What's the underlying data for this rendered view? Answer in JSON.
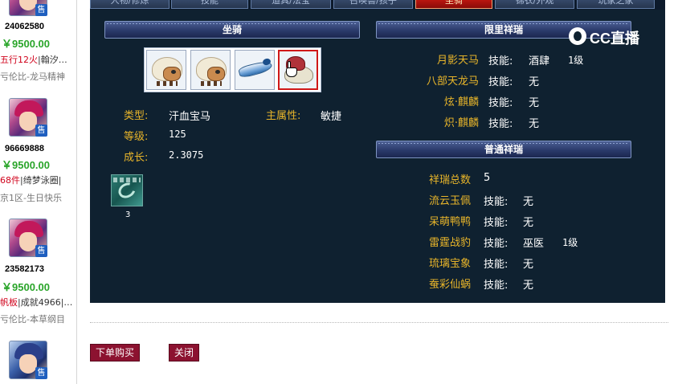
{
  "tabs": [
    "人物/修炼",
    "技能",
    "道具/法宝",
    "召唤兽/孩子",
    "坐骑",
    "锦衣/外观",
    "玩家之家"
  ],
  "active_tab": "坐骑",
  "sellers": [
    {
      "id": "24062580",
      "price": "￥9500.00",
      "tags_red": "五行12火",
      "tags_dark": "|翰汐…",
      "server": "亏伦比-龙马精神"
    },
    {
      "id": "96669888",
      "price": "￥9500.00",
      "tags_red": "68件",
      "tags_dark": "|绮梦泳圈|",
      "server": "京1区-生日快乐"
    },
    {
      "id": "23582173",
      "price": "￥9500.00",
      "tags_red": "帆板",
      "tags_dark": "|成就4966|…",
      "server": "亏伦比-本草纲目"
    }
  ],
  "sell_badge": "售",
  "mount_panel": {
    "title": "坐骑",
    "type_label": "类型:",
    "type_value": "汗血宝马",
    "attr_label": "主属性:",
    "attr_value": "敏捷",
    "level_label": "等级:",
    "level_value": "125",
    "growth_label": "成长:",
    "growth_value": "2.3075",
    "equip_count": "3"
  },
  "limited": {
    "title": "限里祥瑞",
    "skill_label": "技能:",
    "items": [
      {
        "name": "月影天马",
        "skill": "酒肆",
        "level": "1级"
      },
      {
        "name": "八部天龙马",
        "skill": "无",
        "level": ""
      },
      {
        "name": "炫·麒麟",
        "skill": "无",
        "level": ""
      },
      {
        "name": "炽·麒麟",
        "skill": "无",
        "level": ""
      }
    ]
  },
  "common": {
    "title": "普通祥瑞",
    "total_label": "祥瑞总数",
    "total_value": "5",
    "skill_label": "技能:",
    "items": [
      {
        "name": "流云玉佩",
        "skill": "无",
        "level": ""
      },
      {
        "name": "呆萌鸭鸭",
        "skill": "无",
        "level": ""
      },
      {
        "name": "雷霆战豹",
        "skill": "巫医",
        "level": "1级"
      },
      {
        "name": "琉璃宝象",
        "skill": "无",
        "level": ""
      },
      {
        "name": "蚕彩仙蜗",
        "skill": "无",
        "level": ""
      }
    ]
  },
  "watermark": "CC直播",
  "buttons": {
    "buy": "下单购买",
    "close": "关闭"
  }
}
